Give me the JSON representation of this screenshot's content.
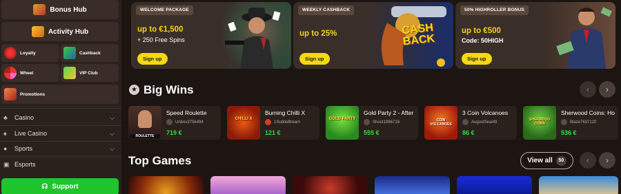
{
  "sidebar": {
    "bonus_hub": "Bonus Hub",
    "activity_hub": "Activity Hub",
    "tiles": [
      "Loyalty",
      "Cashback",
      "Wheel",
      "VIP Club"
    ],
    "promotions": "Promotions",
    "nav": [
      "Casino",
      "Live Casino",
      "Sports",
      "Esports"
    ],
    "support": "Support"
  },
  "promos": [
    {
      "tag": "WELCOME PACKAGE",
      "big": "up to €1,500",
      "sub": "+ 250 Free Spins",
      "button": "Sign up"
    },
    {
      "tag": "WEEKLY CASHBACK",
      "big": "up to 25%",
      "sub": "",
      "button": "Sign up",
      "art_text": [
        "CASH",
        "BACK"
      ]
    },
    {
      "tag": "50% HIGHROLLER BONUS",
      "big": "up to €500",
      "sub": "Code: 50HIGH",
      "button": "Sign up"
    }
  ],
  "big_wins": {
    "title": "Big Wins",
    "items": [
      {
        "game": "Speed Roulette",
        "user": "Unbox3756494",
        "amount": "719 €",
        "thumb_label": "ROULETTE"
      },
      {
        "game": "Burning Chilli X",
        "user": "1SubtleBream",
        "amount": "121 €",
        "thumb_label": "CHILLI X"
      },
      {
        "game": "Gold Party 2 - After",
        "user": "Shoot1996716",
        "amount": "555 €",
        "thumb_label": "GOLD PARTY"
      },
      {
        "game": "3 Coin Volcanoes",
        "user": "AugustSeal49",
        "amount": "86 €",
        "thumb_label": "COIN VOLCANOES"
      },
      {
        "game": "Sherwood Coins: Hold",
        "user": "Blaze7637120",
        "amount": "536 €",
        "thumb_label": "SHERWOOD COINS"
      }
    ]
  },
  "top_games": {
    "title": "Top Games",
    "view_all": "View all",
    "count": "50"
  },
  "colors": {
    "accent_yellow": "#f4d913",
    "support_green": "#1fc52c",
    "win_green": "#2ee03e"
  }
}
